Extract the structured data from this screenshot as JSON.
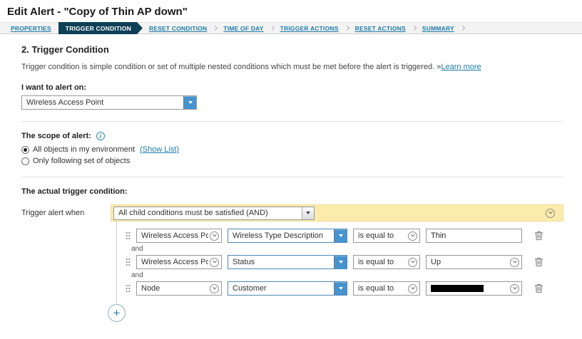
{
  "colors": {
    "accent": "#1e7ca8",
    "active-tab-bg": "#0e4055",
    "group-bar-bg": "#fcecab",
    "dropdown-btn": "#4693cf"
  },
  "icons": {
    "info_glyph": "i"
  },
  "header": {
    "title": "Edit Alert - \"Copy of Thin AP down\""
  },
  "wizard": {
    "steps": [
      {
        "label": "PROPERTIES"
      },
      {
        "label": "TRIGGER CONDITION",
        "active": true
      },
      {
        "label": "RESET CONDITION"
      },
      {
        "label": "TIME OF DAY"
      },
      {
        "label": "TRIGGER ACTIONS"
      },
      {
        "label": "RESET ACTIONS"
      },
      {
        "label": "SUMMARY"
      }
    ]
  },
  "section": {
    "heading": "2. Trigger Condition",
    "description": "Trigger condition is simple condition or set of multiple nested conditions which must be met before the alert is triggered. »",
    "learn_more_label": "Learn more"
  },
  "alert_on": {
    "label": "I want to alert on:",
    "value": "Wireless Access Point"
  },
  "scope": {
    "label": "The scope of alert:",
    "option_all_label": "All objects in my environment",
    "show_list_label": "(Show List)",
    "option_set_label": "Only following set of objects"
  },
  "trigger": {
    "label": "The actual trigger condition:",
    "when_label": "Trigger alert when",
    "group_condition": "All child conditions must be satisfied (AND)",
    "joiner": "and",
    "rows": [
      {
        "object": "Wireless Access Point",
        "field": "Wireless Type Description",
        "operator": "is equal to",
        "value": "Thin",
        "redacted": false
      },
      {
        "object": "Wireless Access Point",
        "field": "Status",
        "operator": "is equal to",
        "value": "Up",
        "redacted": false
      },
      {
        "object": "Node",
        "field": "Customer",
        "operator": "is equal to",
        "value": "",
        "redacted": true
      }
    ],
    "add_label": "+"
  }
}
